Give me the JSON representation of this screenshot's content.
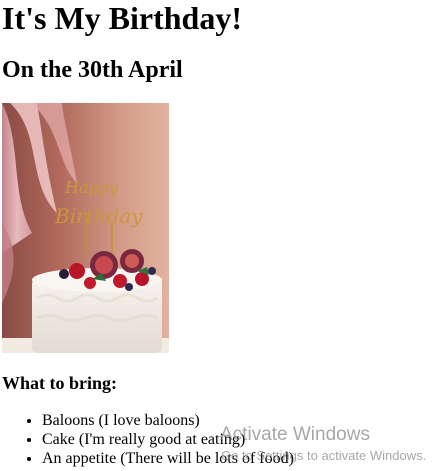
{
  "page": {
    "title": "It's My Birthday!",
    "subtitle": "On the 30th April",
    "image_alt": "Birthday cake with Happy Birthday topper"
  },
  "bring": {
    "heading": "What to bring:",
    "items": [
      "Baloons (I love baloons)",
      "Cake (I'm really good at eating)",
      "An appetite (There will be lots of food)"
    ]
  },
  "overlay": {
    "title": "Activate Windows",
    "subtitle": "Go to Settings to activate Windows."
  },
  "photo": {
    "topper_line1": "Happy",
    "topper_line2": "Birthday"
  }
}
